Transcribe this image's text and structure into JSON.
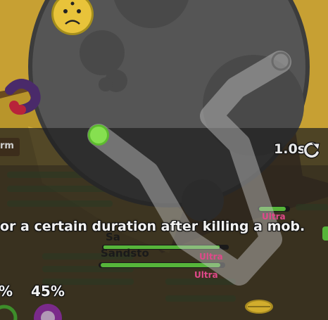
{
  "hud": {
    "description": "or a certain duration after killing a mob.",
    "cooldown": "1.0s",
    "percent_left": "%",
    "percent_45": "45%",
    "chip_label": "rm"
  },
  "mobs": {
    "name_1": "Sa",
    "name_2": "Sandsto",
    "rarity_1": "Ultra",
    "rarity_2": "Ultra",
    "rarity_3": "Ultra"
  },
  "icons": [
    "reload-icon",
    "joystick-dot-icon",
    "sad-face-icon",
    "leaf-icon",
    "hazard-icon"
  ],
  "colors": {
    "sand": "#d9b531",
    "overlay": "#2a2a2a",
    "rock": "#4f4f4f",
    "joystick_dot": "#7fd94a",
    "rarity": "#e0498a",
    "health": "#56b53a"
  }
}
